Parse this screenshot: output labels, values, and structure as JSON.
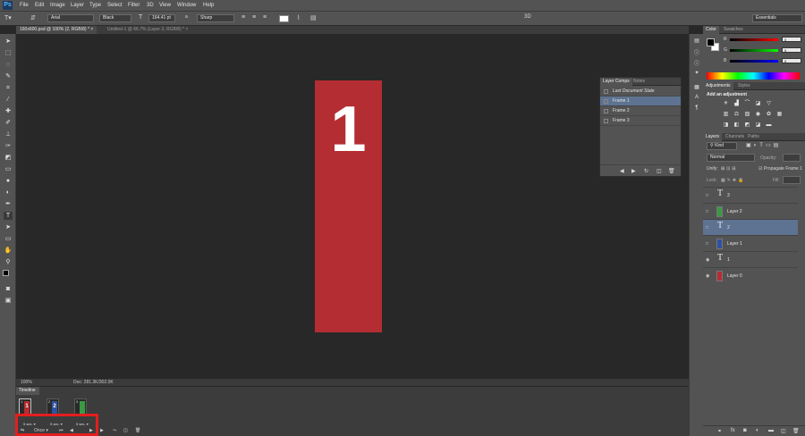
{
  "app": {
    "logo": "Ps",
    "brand_color": "#1c3a5e"
  },
  "menu": [
    "File",
    "Edit",
    "Image",
    "Layer",
    "Type",
    "Select",
    "Filter",
    "3D",
    "View",
    "Window",
    "Help"
  ],
  "options": {
    "font_family": "Arial",
    "font_style": "Black",
    "font_size": "164.41 pt",
    "aa_label": "a",
    "aa_mode": "Sharp",
    "mode_3d": "3D",
    "workspace": "Essentials"
  },
  "tabs": [
    {
      "label": "160x600.psd @ 100% (2, RGB/8) *",
      "active": true
    },
    {
      "label": "Untitled-1 @ 66.7% (Layer 3, RGB/8) *",
      "active": false
    }
  ],
  "document": {
    "text": "1",
    "color": "#b32d32"
  },
  "status": {
    "zoom": "100%",
    "doc": "Doc: 281.3K/302.0K"
  },
  "timeline": {
    "title": "Timeline",
    "frames": [
      {
        "num": "1",
        "label": "1",
        "color": "#b32d32",
        "delay": "5 sec."
      },
      {
        "num": "2",
        "label": "2",
        "color": "#2f52a0",
        "delay": "5 sec."
      },
      {
        "num": "3",
        "label": "",
        "color": "#3a9a42",
        "delay": "5 sec."
      }
    ],
    "loop": "Once"
  },
  "color_panel": {
    "tabs": [
      "Color",
      "Swatches"
    ],
    "r": "0",
    "g": "0",
    "b": "0",
    "r_label": "R",
    "g_label": "G",
    "b_label": "B"
  },
  "adjustments": {
    "tabs": [
      "Adjustments",
      "Styles"
    ],
    "heading": "Add an adjustment"
  },
  "layers_panel": {
    "tabs": [
      "Layers",
      "Channels",
      "Paths"
    ],
    "filter": "Kind",
    "blend": "Normal",
    "opacity_label": "Opacity:",
    "unify_label": "Unify:",
    "propagate_label": "Propagate Frame 1",
    "lock_label": "Lock:",
    "fill_label": "Fill:",
    "layers": [
      {
        "name": "3",
        "type": "text",
        "selected": false,
        "visible": false
      },
      {
        "name": "Layer 2",
        "type": "pixel",
        "color": "#3a9a42",
        "selected": false,
        "visible": false
      },
      {
        "name": "2",
        "type": "text",
        "selected": true,
        "visible": false
      },
      {
        "name": "Layer 1",
        "type": "pixel",
        "color": "#2f52a0",
        "selected": false,
        "visible": false
      },
      {
        "name": "1",
        "type": "text",
        "selected": false,
        "visible": true
      },
      {
        "name": "Layer 0",
        "type": "pixel",
        "color": "#b32d32",
        "selected": false,
        "visible": true
      }
    ]
  },
  "layer_comps": {
    "tabs": [
      "Layer Comps",
      "Notes"
    ],
    "items": [
      {
        "label": "Last Document State",
        "selected": false
      },
      {
        "label": "Frame 1",
        "selected": true
      },
      {
        "label": "Frame 2",
        "selected": false
      },
      {
        "label": "Frame 3",
        "selected": false
      }
    ]
  }
}
